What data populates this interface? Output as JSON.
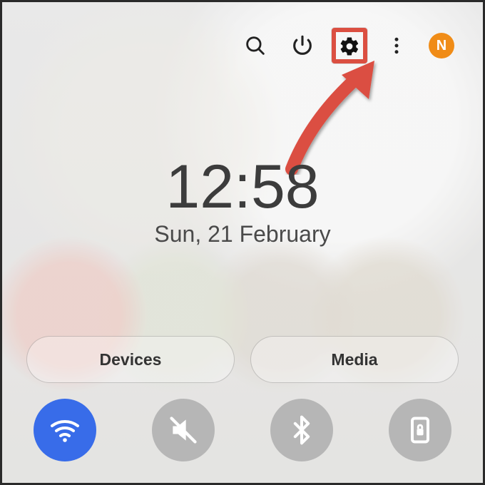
{
  "avatar_letter": "N",
  "time": "12:58",
  "date": "Sun, 21 February",
  "buttons": {
    "devices": "Devices",
    "media": "Media"
  },
  "toggles": {
    "wifi_on": true
  },
  "colors": {
    "accent": "#2f6cff",
    "avatar": "#ff8a00",
    "highlight": "#ef4a3a"
  }
}
